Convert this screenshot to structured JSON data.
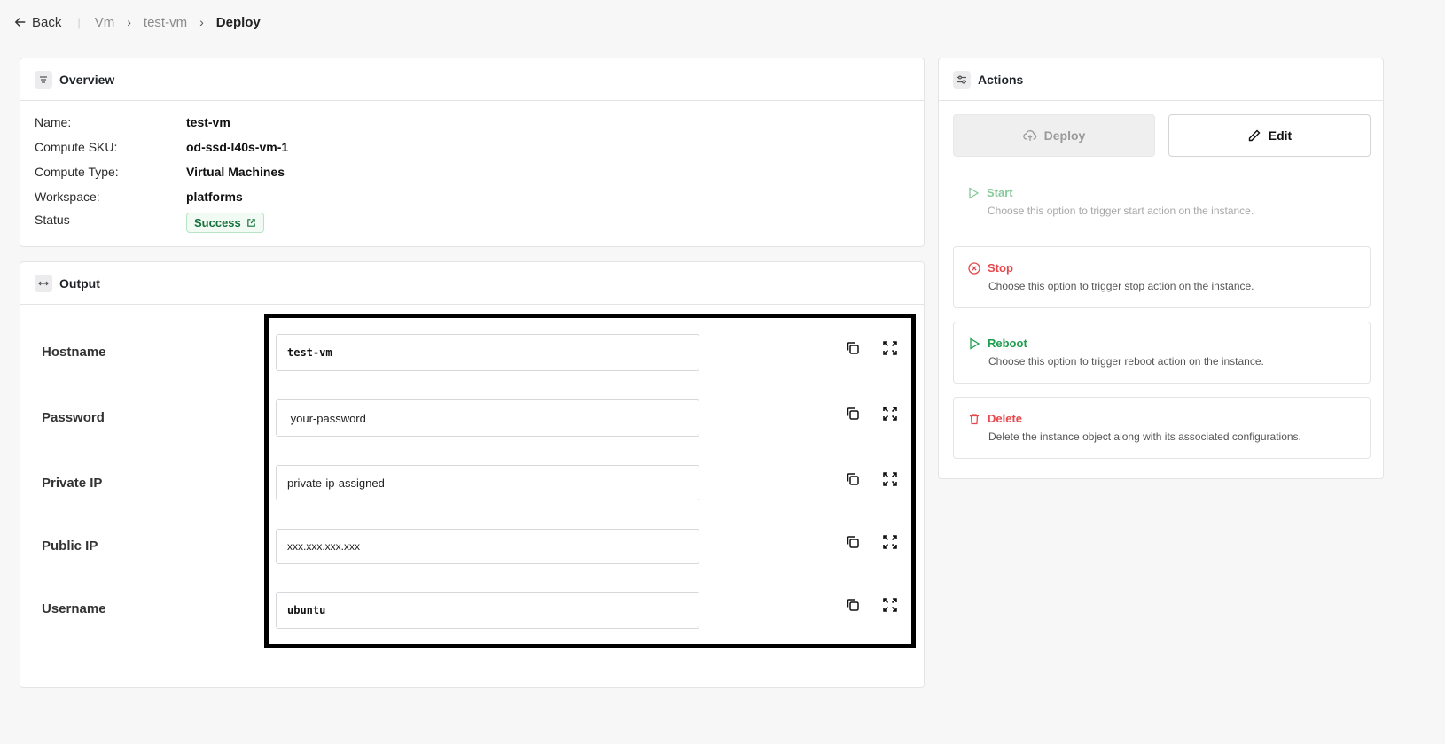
{
  "nav": {
    "back_label": "Back",
    "breadcrumbs": [
      "Vm",
      "test-vm",
      "Deploy"
    ]
  },
  "overview": {
    "title": "Overview",
    "rows": [
      {
        "label": "Name:",
        "value": "test-vm"
      },
      {
        "label": "Compute SKU:",
        "value": "od-ssd-l40s-vm-1"
      },
      {
        "label": "Compute Type:",
        "value": "Virtual Machines"
      },
      {
        "label": "Workspace:",
        "value": "platforms"
      }
    ],
    "status_label": "Status",
    "status_value": "Success"
  },
  "output": {
    "title": "Output",
    "fields": [
      {
        "label": "Hostname",
        "value": "test-vm"
      },
      {
        "label": "Password",
        "value": " your-password"
      },
      {
        "label": "Private IP",
        "value": "private-ip-assigned"
      },
      {
        "label": "Public IP",
        "value": "xxx.xxx.xxx.xxx"
      },
      {
        "label": "Username",
        "value": "ubuntu"
      }
    ]
  },
  "actions": {
    "title": "Actions",
    "deploy_label": "Deploy",
    "edit_label": "Edit",
    "items": [
      {
        "title": "Start",
        "desc": "Choose this option to trigger start action on the instance."
      },
      {
        "title": "Stop",
        "desc": "Choose this option to trigger stop action on the instance."
      },
      {
        "title": "Reboot",
        "desc": "Choose this option to trigger reboot action on the instance."
      },
      {
        "title": "Delete",
        "desc": "Delete the instance object along with its associated configurations."
      }
    ]
  },
  "colors": {
    "success": "#15703a",
    "danger": "#e5484d",
    "reboot": "#1f9d4f",
    "start_disabled": "#86c99b"
  }
}
